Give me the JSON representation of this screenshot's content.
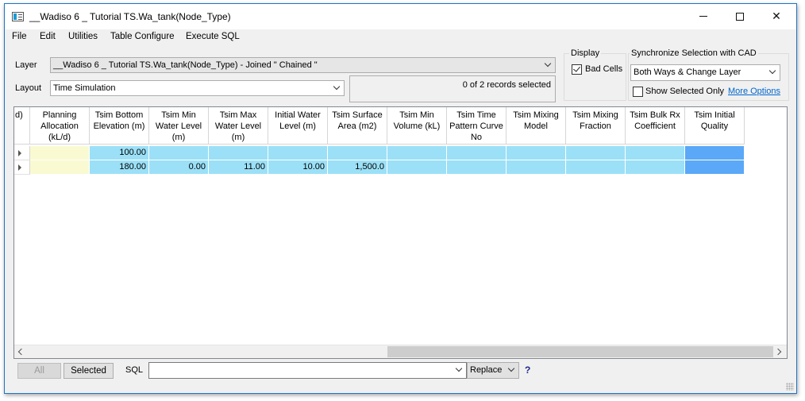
{
  "window": {
    "title": "__Wadiso 6 _ Tutorial TS.Wa_tank(Node_Type)"
  },
  "menu": [
    "File",
    "Edit",
    "Utilities",
    "Table Configure",
    "Execute SQL"
  ],
  "layer": {
    "label": "Layer",
    "value": "__Wadiso 6 _ Tutorial TS.Wa_tank(Node_Type) - Joined \" Chained \""
  },
  "layout": {
    "label": "Layout",
    "value": "Time Simulation"
  },
  "records": {
    "text": "0 of 2 records selected"
  },
  "display": {
    "title": "Display",
    "bad_cells_label": "Bad Cells",
    "bad_cells_checked": true
  },
  "sync": {
    "title": "Synchronize Selection with CAD",
    "value": "Both Ways & Change Layer",
    "show_selected_label": "Show Selected Only",
    "show_selected_checked": false,
    "more_options": "More Options"
  },
  "table": {
    "first_col_fragment": "d)",
    "columns": [
      "Planning Allocation (kL/d)",
      "Tsim Bottom Elevation (m)",
      "Tsim Min Water Level (m)",
      "Tsim Max Water Level (m)",
      "Initial Water Level (m)",
      "Tsim Surface Area (m2)",
      "Tsim Min Volume (kL)",
      "Tsim Time Pattern Curve No",
      "Tsim Mixing Model",
      "Tsim Mixing Fraction",
      "Tsim Bulk Rx Coefficient",
      "Tsim Initial Quality"
    ],
    "rows": [
      [
        "",
        "100.00",
        "",
        "",
        "",
        "",
        "",
        "",
        "",
        "",
        "",
        ""
      ],
      [
        "",
        "180.00",
        "0.00",
        "11.00",
        "10.00",
        "1,500.0",
        "",
        "",
        "",
        "",
        "",
        ""
      ]
    ]
  },
  "bottom": {
    "all_label": "All",
    "selected_label": "Selected",
    "sql_label": "SQL",
    "sql_value": "",
    "replace_value": "Replace",
    "help_label": "?"
  },
  "colors": {
    "cell_blue": "#9be0f7",
    "cell_yellow": "#fafad2",
    "last_col_blue": "#5aa8f7",
    "accent_border": "#1f74c8"
  }
}
